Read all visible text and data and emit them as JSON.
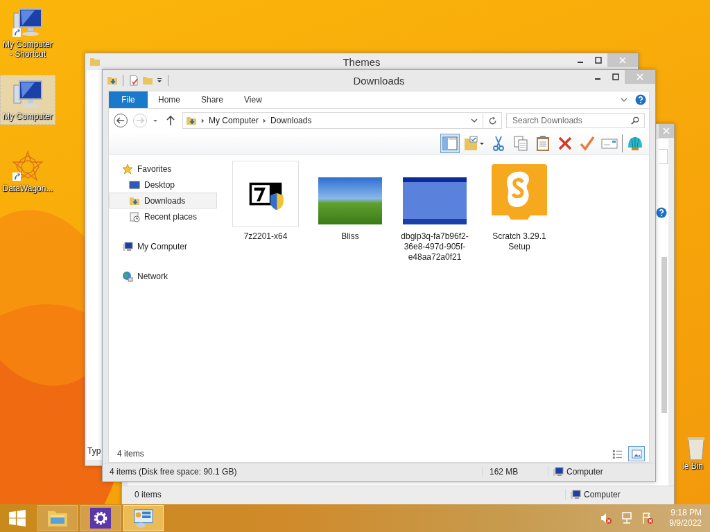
{
  "desktop": {
    "icons": [
      {
        "label": "My Computer - Shortcut",
        "kind": "computer",
        "shortcut": true,
        "selected": false
      },
      {
        "label": "My Computer",
        "kind": "computer",
        "shortcut": false,
        "selected": true
      },
      {
        "label": "DataWagon...",
        "kind": "star",
        "shortcut": true,
        "selected": false
      }
    ],
    "recycle_bin": {
      "label": "le Bin"
    }
  },
  "themes_window": {
    "title": "Themes",
    "column_label": "Typ"
  },
  "second_window": {
    "status": "0 items",
    "location": "Computer"
  },
  "window": {
    "title": "Downloads",
    "ribbon_tabs": [
      {
        "label": "File",
        "kind": "menu"
      },
      {
        "label": "Home",
        "kind": "tab"
      },
      {
        "label": "Share",
        "kind": "tab"
      },
      {
        "label": "View",
        "kind": "tab"
      }
    ],
    "path": [
      "My Computer",
      "Downloads"
    ],
    "search": {
      "placeholder": "Search Downloads"
    },
    "toolbar": [
      {
        "kind": "pane",
        "selected": true
      },
      {
        "kind": "folder-check",
        "selected": false
      },
      {
        "kind": "cut",
        "selected": false
      },
      {
        "kind": "copy",
        "selected": false
      },
      {
        "kind": "paste",
        "selected": false
      },
      {
        "kind": "delete",
        "selected": false
      },
      {
        "kind": "check",
        "selected": false
      },
      {
        "kind": "mail",
        "selected": false
      },
      {
        "kind": "shell",
        "selected": false
      }
    ],
    "nav": [
      {
        "label": "Favorites",
        "kind": "favorites",
        "selected": false,
        "children": [
          {
            "label": "Desktop",
            "kind": "desktop",
            "selected": false
          },
          {
            "label": "Downloads",
            "kind": "downloads",
            "selected": true
          },
          {
            "label": "Recent places",
            "kind": "recent",
            "selected": false
          }
        ]
      },
      {
        "label": "My Computer",
        "kind": "computer",
        "selected": false
      },
      {
        "label": "Network",
        "kind": "network",
        "selected": false
      }
    ],
    "files": [
      {
        "name": "7z2201-x64",
        "kind": "installer",
        "hovered": true
      },
      {
        "name": "Bliss",
        "kind": "landscape",
        "hovered": false
      },
      {
        "name": "dbglp3q-fa7b96f2-36e8-497d-905f-e48aa72a0f21",
        "kind": "blue",
        "hovered": false
      },
      {
        "name": "Scratch 3.29.1 Setup",
        "kind": "scratch",
        "hovered": false
      }
    ],
    "item_count": "4 items",
    "view_buttons": [
      {
        "kind": "details",
        "selected": false
      },
      {
        "kind": "large-icons",
        "selected": true
      }
    ],
    "status_bar": {
      "summary": "4 items (Disk free space: 90.1 GB)",
      "size": "162 MB",
      "location": "Computer"
    }
  },
  "taskbar": {
    "apps": [
      {
        "kind": "explorer",
        "active": false
      },
      {
        "kind": "settings",
        "active": false
      },
      {
        "kind": "control-panel",
        "active": true
      }
    ],
    "time": "9:18 PM",
    "date": "9/9/2022"
  }
}
